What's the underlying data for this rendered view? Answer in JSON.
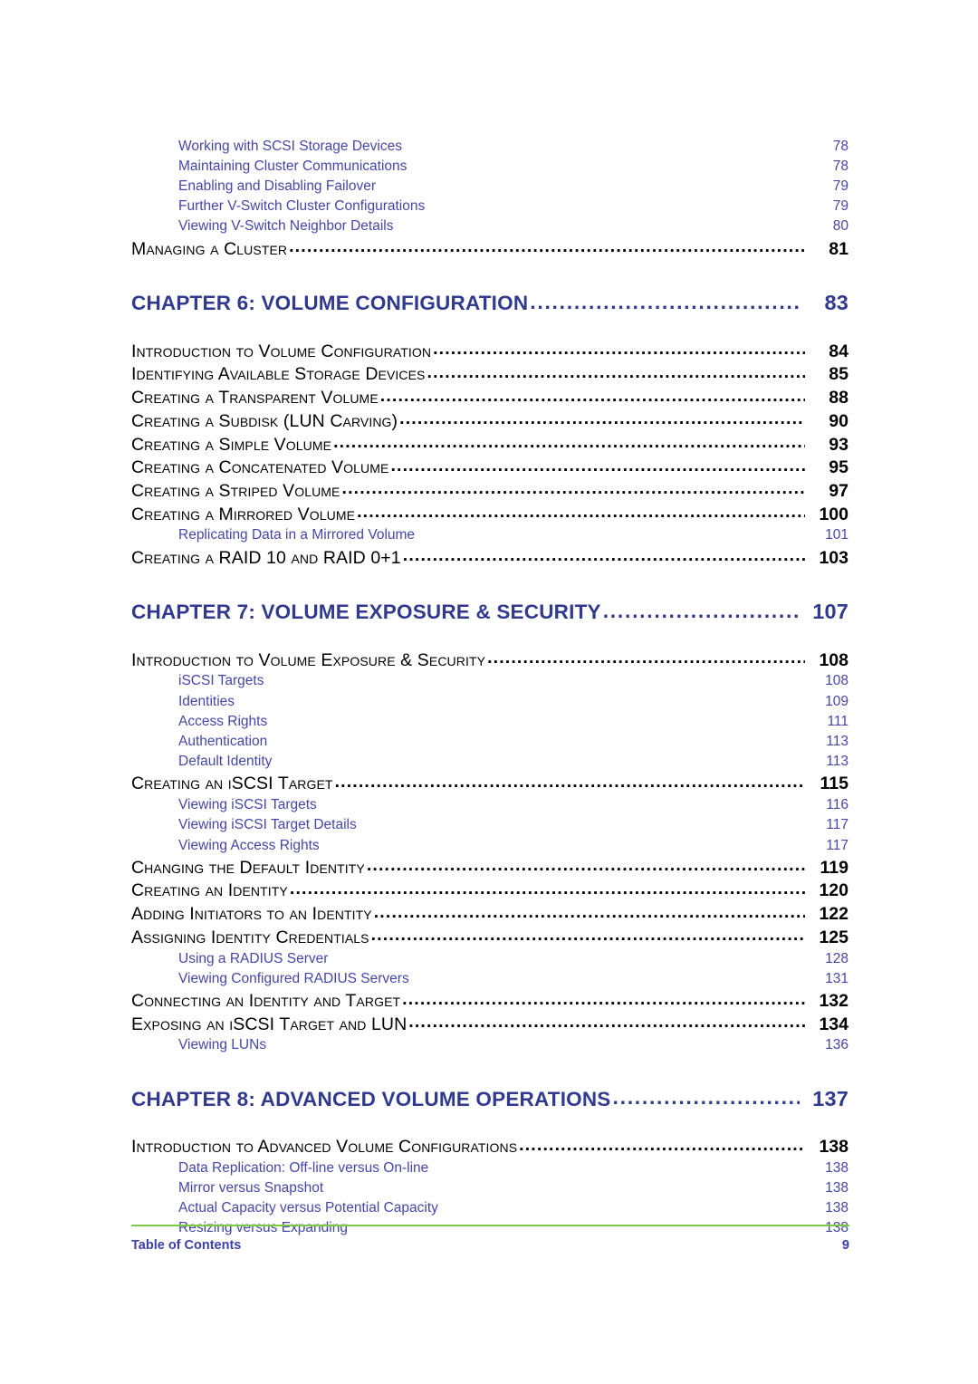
{
  "document": {
    "footer_label": "Table of Contents",
    "page_number": "9",
    "rule_color": "#7ac943",
    "chapter_color": "#313a8e",
    "sub_entry_color": "#4547a8",
    "main_entry_color": "#000000"
  },
  "toc": {
    "blocks": [
      {
        "type": "entries",
        "items": [
          {
            "level": 2,
            "title": "Working with SCSI Storage Devices",
            "page": "78"
          },
          {
            "level": 2,
            "title": "Maintaining Cluster Communications",
            "page": "78"
          },
          {
            "level": 2,
            "title": "Enabling and Disabling Failover",
            "page": "79"
          },
          {
            "level": 2,
            "title": "Further V-Switch Cluster Configurations",
            "page": "79"
          },
          {
            "level": 2,
            "title": "Viewing V-Switch Neighbor Details",
            "page": "80"
          },
          {
            "level": 1,
            "title": "Managing a Cluster",
            "page": "81"
          }
        ]
      },
      {
        "type": "chapter",
        "title": "CHAPTER 6:  VOLUME CONFIGURATION",
        "page": "83",
        "items": [
          {
            "level": 1,
            "title": "Introduction to Volume Configuration",
            "page": "84"
          },
          {
            "level": 1,
            "title": "Identifying Available Storage Devices",
            "page": "85"
          },
          {
            "level": 1,
            "title": "Creating a Transparent Volume",
            "page": "88"
          },
          {
            "level": 1,
            "title": "Creating a Subdisk (LUN Carving)",
            "page": "90",
            "caps": [
              "LUN"
            ]
          },
          {
            "level": 1,
            "title": "Creating a Simple Volume",
            "page": "93"
          },
          {
            "level": 1,
            "title": "Creating a Concatenated Volume",
            "page": "95"
          },
          {
            "level": 1,
            "title": "Creating a Striped Volume",
            "page": "97"
          },
          {
            "level": 1,
            "title": "Creating a Mirrored Volume",
            "page": "100"
          },
          {
            "level": 2,
            "title": "Replicating Data in a Mirrored Volume",
            "page": "101"
          },
          {
            "level": 1,
            "title": "Creating a RAID 10 and RAID 0+1",
            "page": "103",
            "caps": [
              "RAID 10",
              "RAID 0+1"
            ]
          }
        ]
      },
      {
        "type": "chapter",
        "title": "CHAPTER 7:  VOLUME EXPOSURE & SECURITY",
        "page": "107",
        "items": [
          {
            "level": 1,
            "title": "Introduction to Volume Exposure & Security",
            "page": "108"
          },
          {
            "level": 2,
            "title": "iSCSI Targets",
            "page": "108"
          },
          {
            "level": 2,
            "title": "Identities",
            "page": "109"
          },
          {
            "level": 2,
            "title": "Access Rights",
            "page": "111"
          },
          {
            "level": 2,
            "title": "Authentication",
            "page": "113"
          },
          {
            "level": 2,
            "title": "Default Identity",
            "page": "113"
          },
          {
            "level": 1,
            "title": "Creating an iSCSI Target",
            "page": "115"
          },
          {
            "level": 2,
            "title": "Viewing iSCSI Targets",
            "page": "116"
          },
          {
            "level": 2,
            "title": "Viewing iSCSI Target Details",
            "page": "117"
          },
          {
            "level": 2,
            "title": "Viewing Access Rights",
            "page": "117"
          },
          {
            "level": 1,
            "title": "Changing the Default Identity",
            "page": "119"
          },
          {
            "level": 1,
            "title": "Creating an Identity",
            "page": "120"
          },
          {
            "level": 1,
            "title": "Adding Initiators to an Identity",
            "page": "122"
          },
          {
            "level": 1,
            "title": "Assigning Identity Credentials",
            "page": "125"
          },
          {
            "level": 2,
            "title": "Using a RADIUS Server",
            "page": "128"
          },
          {
            "level": 2,
            "title": "Viewing Configured RADIUS Servers",
            "page": "131"
          },
          {
            "level": 1,
            "title": "Connecting an Identity and Target",
            "page": "132"
          },
          {
            "level": 1,
            "title": "Exposing an iSCSI Target and LUN",
            "page": "134",
            "caps": [
              "LUN"
            ]
          },
          {
            "level": 2,
            "title": "Viewing LUNs",
            "page": "136"
          }
        ]
      },
      {
        "type": "chapter",
        "title": "CHAPTER 8:  ADVANCED VOLUME OPERATIONS",
        "page": "137",
        "items": [
          {
            "level": 1,
            "title": "Introduction to Advanced Volume Configurations",
            "page": "138"
          },
          {
            "level": 2,
            "title": "Data Replication:  Off-line versus On-line",
            "page": "138"
          },
          {
            "level": 2,
            "title": "Mirror versus Snapshot",
            "page": "138"
          },
          {
            "level": 2,
            "title": "Actual Capacity versus Potential Capacity",
            "page": "138"
          },
          {
            "level": 2,
            "title": "Resizing versus Expanding",
            "page": "138"
          }
        ]
      }
    ]
  }
}
